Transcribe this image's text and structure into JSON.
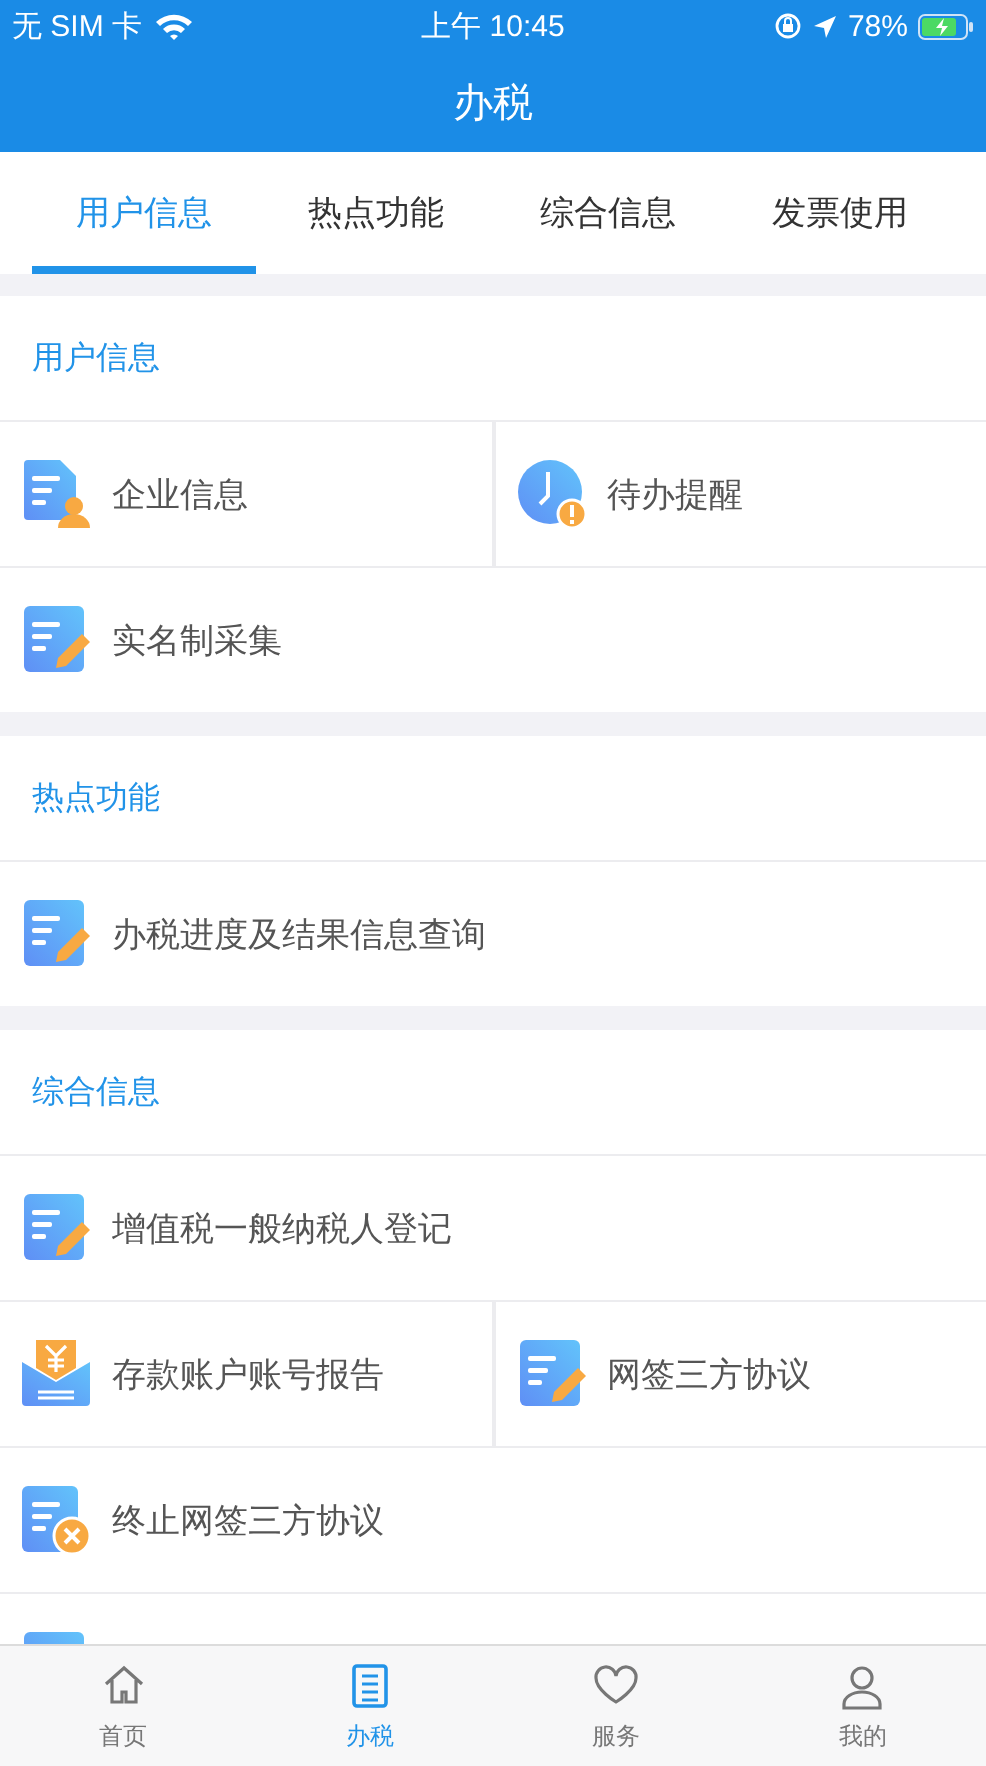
{
  "status_bar": {
    "carrier": "无 SIM 卡",
    "time": "上午 10:45",
    "battery": "78%"
  },
  "header": {
    "title": "办税"
  },
  "tabs": [
    {
      "label": "用户信息",
      "selected": true
    },
    {
      "label": "热点功能",
      "selected": false
    },
    {
      "label": "综合信息",
      "selected": false
    },
    {
      "label": "发票使用",
      "selected": false
    }
  ],
  "sections": [
    {
      "title": "用户信息",
      "rows": [
        [
          {
            "label": "企业信息",
            "kind": "person"
          },
          {
            "label": "待办提醒",
            "kind": "reminder"
          }
        ],
        [
          {
            "label": "实名制采集",
            "kind": "edit"
          }
        ]
      ]
    },
    {
      "title": "热点功能",
      "rows": [
        [
          {
            "label": "办税进度及结果信息查询",
            "kind": "edit"
          }
        ]
      ]
    },
    {
      "title": "综合信息",
      "rows": [
        [
          {
            "label": "增值税一般纳税人登记",
            "kind": "edit"
          }
        ],
        [
          {
            "label": "存款账户账号报告",
            "kind": "deposit"
          },
          {
            "label": "网签三方协议",
            "kind": "edit"
          }
        ],
        [
          {
            "label": "终止网签三方协议",
            "kind": "cancel"
          }
        ],
        [
          {
            "kind": "edit"
          }
        ]
      ]
    }
  ],
  "bottom_nav": [
    {
      "label": "首页",
      "selected": false
    },
    {
      "label": "办税",
      "selected": true
    },
    {
      "label": "服务",
      "selected": false
    },
    {
      "label": "我的",
      "selected": false
    }
  ]
}
